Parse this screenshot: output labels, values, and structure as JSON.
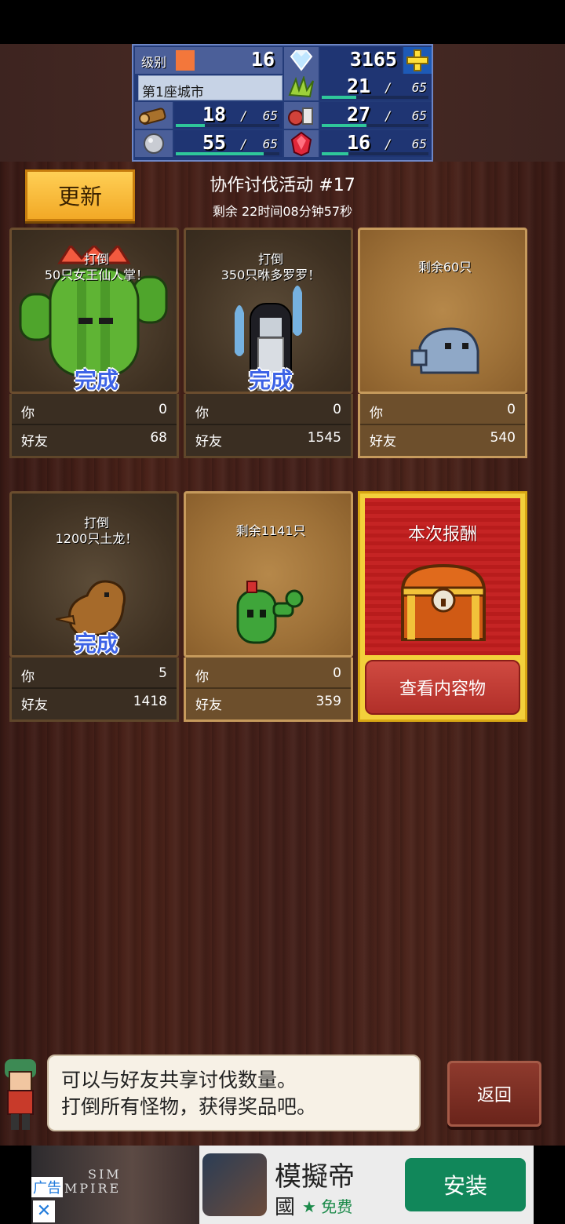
{
  "stats": {
    "level_label": "级别",
    "level": "16",
    "gems": "3165",
    "city": "第1座城市",
    "grass": {
      "value": "21",
      "max": "65",
      "fill": 0.32
    },
    "wood": {
      "value": "18",
      "max": "65",
      "fill": 0.28
    },
    "food": {
      "value": "27",
      "max": "65",
      "fill": 0.42
    },
    "stone": {
      "value": "55",
      "max": "65",
      "fill": 0.85
    },
    "ruby": {
      "value": "16",
      "max": "65",
      "fill": 0.25
    }
  },
  "header": {
    "refresh_label": "更新",
    "event_title": "协作讨伐活动 #17",
    "remaining": "剩余 22时间08分钟57秒"
  },
  "cards": [
    {
      "goal1": "打倒",
      "goal2": "50只女王仙人掌！",
      "done": "完成",
      "you_label": "你",
      "you": "0",
      "friend_label": "好友",
      "friend": "68",
      "monster": "cactus-queen"
    },
    {
      "goal1": "打倒",
      "goal2": "350只咻多罗罗！",
      "done": "完成",
      "you_label": "你",
      "you": "0",
      "friend_label": "好友",
      "friend": "1545",
      "monster": "ghost-girl"
    },
    {
      "goal1": "剩余60只",
      "goal2": "",
      "done": "",
      "you_label": "你",
      "you": "0",
      "friend_label": "好友",
      "friend": "540",
      "monster": "blue-blob"
    },
    {
      "goal1": "打倒",
      "goal2": "1200只土龙！",
      "done": "完成",
      "you_label": "你",
      "you": "5",
      "friend_label": "好友",
      "friend": "1418",
      "monster": "earth-dragon"
    },
    {
      "goal1": "剩余1141只",
      "goal2": "",
      "done": "",
      "you_label": "你",
      "you": "0",
      "friend_label": "好友",
      "friend": "359",
      "monster": "green-cactus"
    }
  ],
  "reward": {
    "title": "本次报酬",
    "button": "查看内容物"
  },
  "dialog": {
    "line1": "可以与好友共享讨伐数量。",
    "line2": "打倒所有怪物，获得奖品吧。"
  },
  "back_label": "返回",
  "ad": {
    "tag": "广告",
    "close": "✕",
    "brand1": "SIM",
    "brand2": "MPIRE",
    "name1": "模擬帝",
    "name2": "國",
    "free": "★ 免费",
    "install": "安装"
  }
}
